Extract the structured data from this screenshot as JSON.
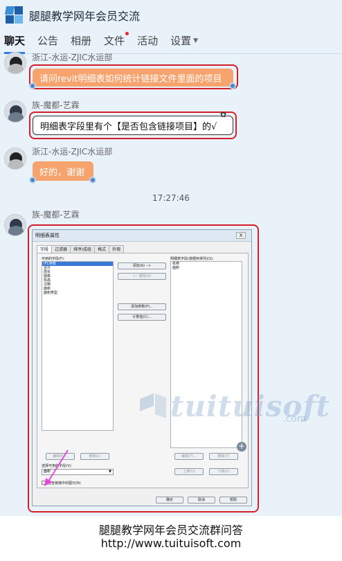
{
  "app": {
    "title": "腿腿教学网年会员交流"
  },
  "tabs": [
    {
      "label": "聊天"
    },
    {
      "label": "公告"
    },
    {
      "label": "相册"
    },
    {
      "label": "文件"
    },
    {
      "label": "活动"
    },
    {
      "label": "设置"
    }
  ],
  "messages": [
    {
      "sender": "浙江-水运-ZJIC水运部",
      "text": "请问revit明细表如何统计链接文件里面的项目"
    },
    {
      "sender": "族-魔都-艺霖",
      "text": "明细表字段里有个【是否包含链接项目】的√"
    },
    {
      "sender": "浙江-水运-ZJIC水运部",
      "text": "好的，谢谢"
    }
  ],
  "timestamp": "17:27:46",
  "last_sender": "族-魔都-艺霖",
  "dialog": {
    "title": "明细表属性",
    "close": "X",
    "tabs": [
      "字段",
      "过滤器",
      "排序/成组",
      "格式",
      "外观"
    ],
    "available_label": "可用的字段(F):",
    "available_items": [
      "IFC参数",
      "合计",
      "周长",
      "图像",
      "标高",
      "注释",
      "面积",
      "面积类型"
    ],
    "scheduled_label": "明细表字段(按顺序排列)(S):",
    "scheduled_items": [
      "名称",
      "面积"
    ],
    "add": "添加(A) -->",
    "remove": "<-- 删除(R)",
    "add_param": "添加参数(P)...",
    "calc": "计算值(C)...",
    "edit_left": "编辑(E)...",
    "delete_left": "删除(L)",
    "edit_right": "编辑(T)...",
    "delete_right": "删除(T)",
    "move_up": "上移(U)",
    "move_down": "下移(D)",
    "select_label": "选择可用的字段(V):",
    "select_value": "面积",
    "include_links": "包含链接中的图元(N)",
    "ok": "确定",
    "cancel": "取消",
    "help": "帮助"
  },
  "watermark": {
    "brand": "tuituisoft",
    "suffix": ".com"
  },
  "footer": {
    "line1": "腿腿教学网年会员交流群问答",
    "line2": "http://www.tuituisoft.com"
  },
  "colors": {
    "accent": "#2a7de1",
    "highlight": "#d21f2a",
    "bubble": "#f7a36e"
  }
}
